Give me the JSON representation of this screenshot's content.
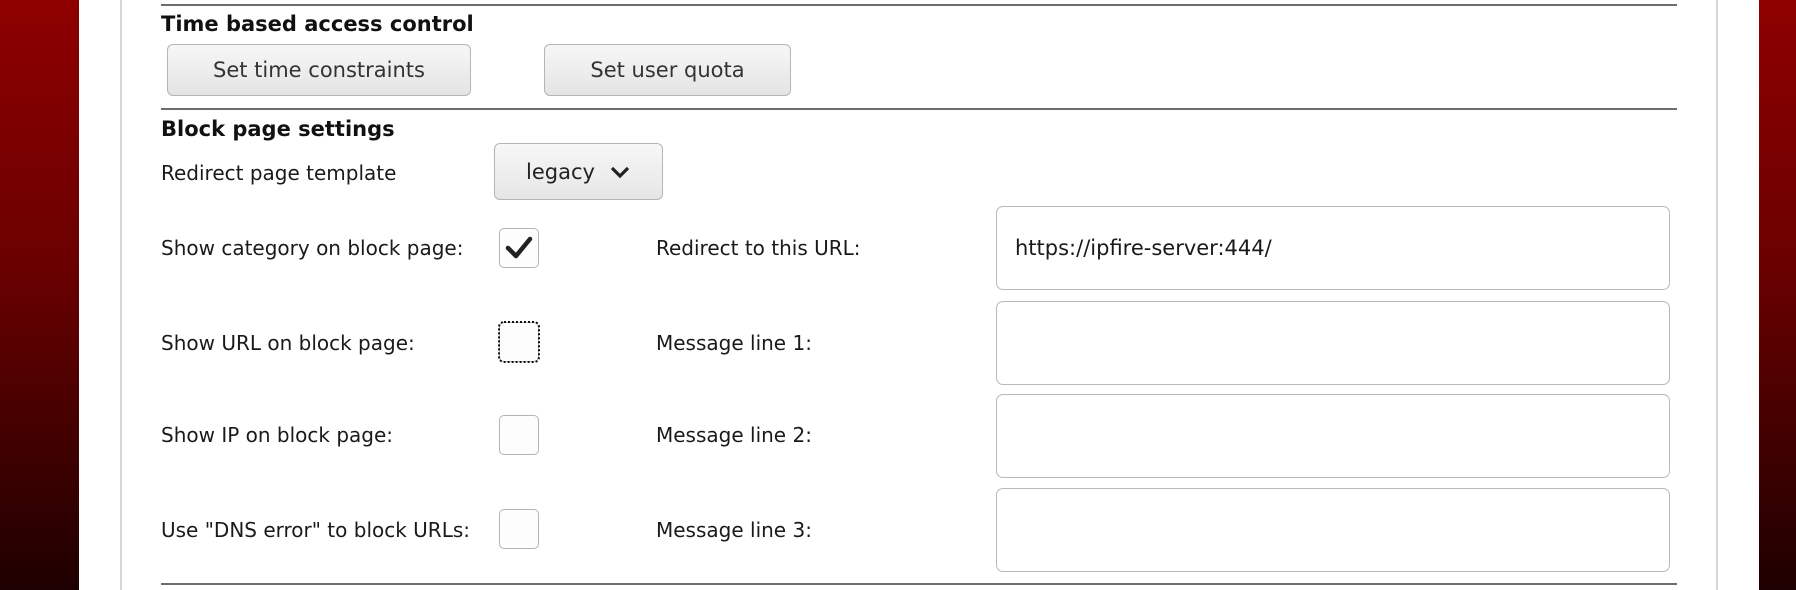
{
  "time_access": {
    "heading": "Time based access control",
    "set_time_constraints_label": "Set time constraints",
    "set_user_quota_label": "Set user quota"
  },
  "block_page": {
    "heading": "Block page settings",
    "redirect_template_label": "Redirect page template",
    "redirect_template_value": "legacy",
    "show_category_label": "Show category on block page:",
    "show_category_checked": true,
    "show_url_label": "Show URL on block page:",
    "show_url_checked": false,
    "show_ip_label": "Show IP on block page:",
    "show_ip_checked": false,
    "dns_error_label": "Use \"DNS error\" to block URLs:",
    "dns_error_checked": false,
    "redirect_url_label": "Redirect to this URL:",
    "redirect_url_value": "https://ipfire-server:444/",
    "message1_label": "Message line 1:",
    "message1_value": "",
    "message2_label": "Message line 2:",
    "message2_value": "",
    "message3_label": "Message line 3:",
    "message3_value": ""
  },
  "icons": {
    "checkmark": "check-icon",
    "dropdown": "chevron-down-icon"
  },
  "colors": {
    "background_top": "#8e0000",
    "background_bottom": "#1e0000",
    "panel": "#ffffff",
    "divider": "#6e6e6e"
  }
}
